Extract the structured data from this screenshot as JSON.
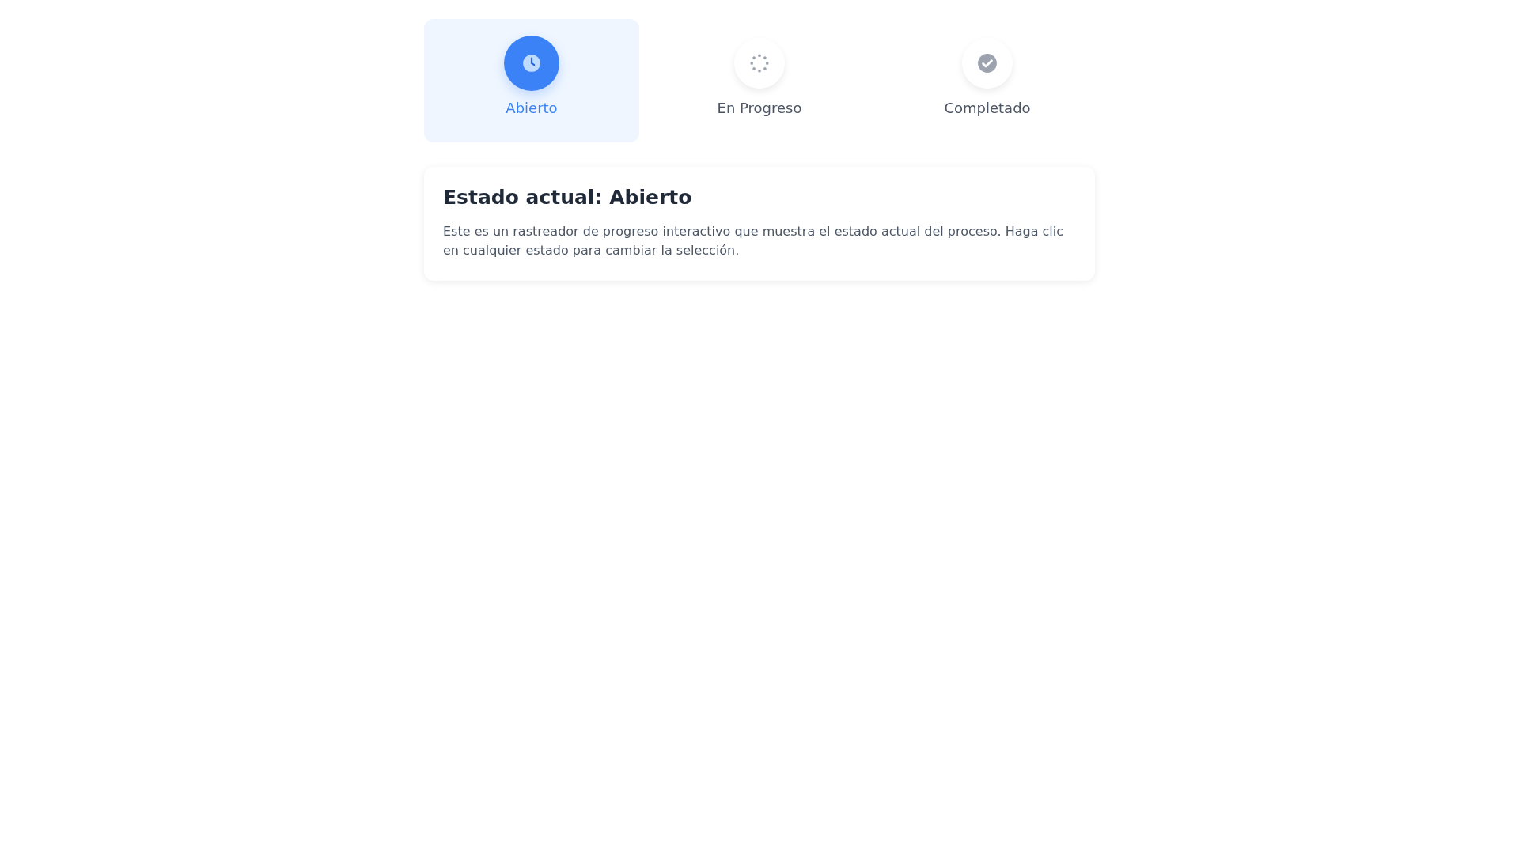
{
  "steps": [
    {
      "kind": "clock",
      "label": "Abierto",
      "selected": true
    },
    {
      "kind": "spinner",
      "label": "En Progreso",
      "selected": false
    },
    {
      "kind": "check",
      "label": "Completado",
      "selected": false
    }
  ],
  "info": {
    "title": "Estado actual: Abierto",
    "description": "Este es un rastreador de progreso interactivo que muestra el estado actual del proceso. Haga clic en cualquier estado para cambiar la selección."
  }
}
